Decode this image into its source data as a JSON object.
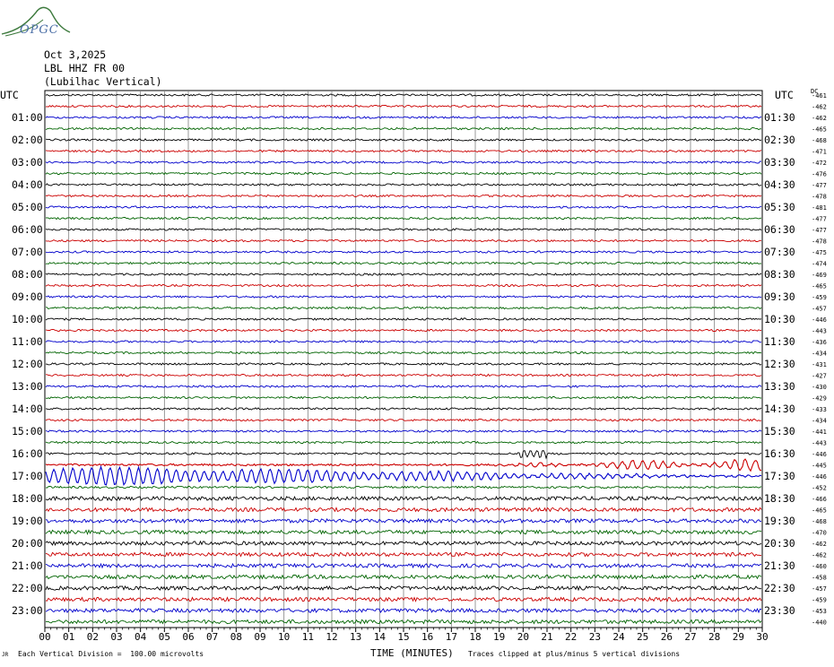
{
  "logo": {
    "text": "OPGC",
    "color": "#4a6ea6"
  },
  "header": {
    "date": "Oct 3,2025",
    "station": "LBL HHZ FR 00",
    "location": "(Lubilhac Vertical)"
  },
  "axis_labels": {
    "left": "UTC",
    "right": "UTC",
    "offset": "DC"
  },
  "footer": {
    "scale": "Each Vertical Division =  100.00 microvolts",
    "x_title": "TIME (MINUTES)",
    "clip_note": "Traces clipped at plus/minus 5 vertical divisions",
    "corner_mark": "JR"
  },
  "colors": {
    "trace_cycle": [
      "#000000",
      "#cc0000",
      "#0000cc",
      "#006400"
    ],
    "grid": "#808080"
  },
  "chart_data": {
    "type": "line",
    "title": "",
    "xlabel": "TIME (MINUTES)",
    "ylabel": "",
    "x_ticks": [
      "00",
      "01",
      "02",
      "03",
      "04",
      "05",
      "06",
      "07",
      "08",
      "09",
      "10",
      "11",
      "12",
      "13",
      "14",
      "15",
      "16",
      "17",
      "18",
      "19",
      "20",
      "21",
      "22",
      "23",
      "24",
      "25",
      "26",
      "27",
      "28",
      "29",
      "30"
    ],
    "xlim": [
      0,
      30
    ],
    "left_labels": [
      "",
      "01:00",
      "02:00",
      "03:00",
      "04:00",
      "05:00",
      "06:00",
      "07:00",
      "08:00",
      "09:00",
      "10:00",
      "11:00",
      "12:00",
      "13:00",
      "14:00",
      "15:00",
      "16:00",
      "17:00",
      "18:00",
      "19:00",
      "20:00",
      "21:00",
      "22:00",
      "23:00"
    ],
    "right_labels": [
      "",
      "01:30",
      "02:30",
      "03:30",
      "04:30",
      "05:30",
      "06:30",
      "07:30",
      "08:30",
      "09:30",
      "10:30",
      "11:30",
      "12:30",
      "13:30",
      "14:30",
      "15:30",
      "16:30",
      "17:30",
      "18:30",
      "19:30",
      "20:30",
      "21:30",
      "22:30",
      "23:30"
    ],
    "dc_offsets": [
      "-461",
      "-462",
      "-462",
      "-465",
      "-468",
      "-471",
      "-472",
      "-476",
      "-477",
      "-478",
      "-481",
      "-477",
      "-477",
      "-478",
      "-475",
      "-474",
      "-469",
      "-465",
      "-459",
      "-457",
      "-446",
      "-443",
      "-436",
      "-434",
      "-431",
      "-427",
      "-430",
      "-429",
      "-433",
      "-434",
      "-441",
      "-443",
      "-446",
      "-445",
      "-446",
      "-452",
      "-466",
      "-465",
      "-468",
      "-470",
      "-462",
      "-462",
      "-460",
      "-458",
      "-457",
      "-459",
      "-453",
      "-440"
    ],
    "grid": true,
    "traces": 48,
    "event": {
      "start_trace": 33,
      "end_trace": 34,
      "description": "large oscillation",
      "visible_trace_text": ""
    }
  }
}
